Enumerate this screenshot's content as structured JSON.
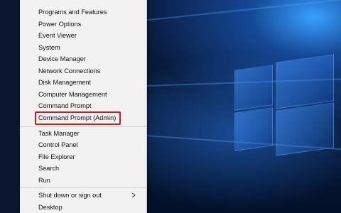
{
  "menu": {
    "groups": [
      {
        "items": [
          "Programs and Features",
          "Power Options",
          "Event Viewer",
          "System",
          "Device Manager",
          "Network Connections",
          "Disk Management",
          "Computer Management",
          "Command Prompt",
          "Command Prompt (Admin)"
        ]
      },
      {
        "items": [
          "Task Manager",
          "Control Panel",
          "File Explorer",
          "Search",
          "Run"
        ]
      },
      {
        "items": [
          "Shut down or sign out",
          "Desktop"
        ]
      }
    ],
    "highlighted_item": "Command Prompt (Admin)",
    "highlight_color": "#d31a1a",
    "submenu_icon": "chevron-right-icon"
  },
  "desktop": {
    "wallpaper": "windows-10-hero",
    "accent": "#1e78e6"
  }
}
